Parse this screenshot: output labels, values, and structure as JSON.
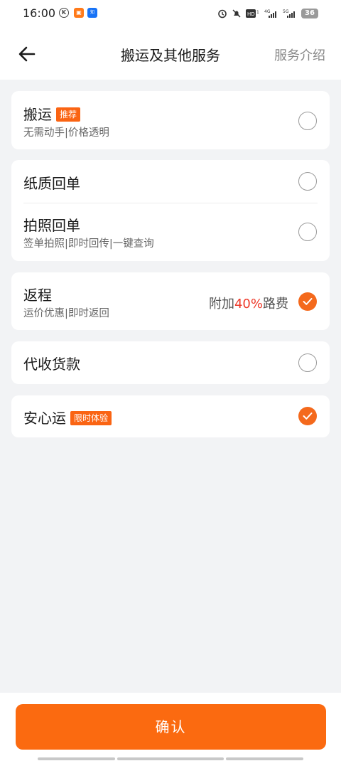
{
  "status_bar": {
    "time": "16:00",
    "battery": "36"
  },
  "nav": {
    "title": "搬运及其他服务",
    "right_link": "服务介绍"
  },
  "options": {
    "carry": {
      "title": "搬运",
      "badge": "推荐",
      "subtitle": "无需动手|价格透明",
      "selected": false
    },
    "paper_receipt": {
      "title": "纸质回单",
      "selected": false
    },
    "photo_receipt": {
      "title": "拍照回单",
      "subtitle": "签单拍照|即时回传|一键查询",
      "selected": false
    },
    "return_trip": {
      "title": "返程",
      "subtitle": "运价优惠|即时返回",
      "extra_prefix": "附加",
      "extra_percent": "40%",
      "extra_suffix": "路费",
      "selected": true
    },
    "cod": {
      "title": "代收货款",
      "selected": false
    },
    "peace_of_mind": {
      "title": "安心运",
      "badge": "限时体验",
      "selected": true
    }
  },
  "confirm_button": {
    "label": "确认"
  },
  "colors": {
    "accent": "#fb6a10",
    "highlight": "#ee3a2a",
    "background": "#f2f3f5"
  }
}
